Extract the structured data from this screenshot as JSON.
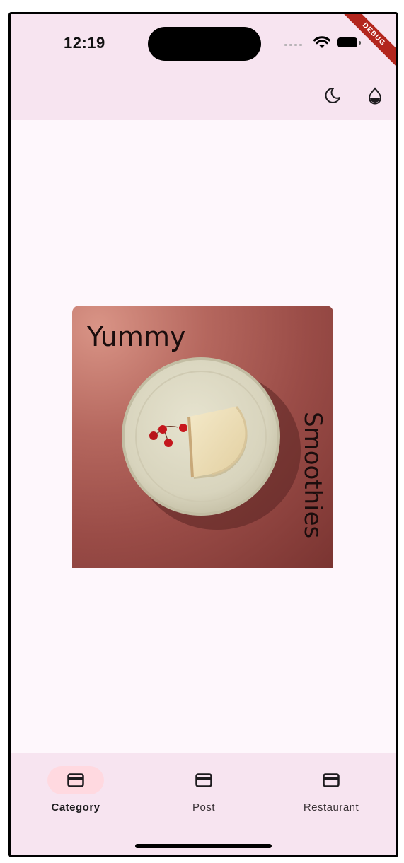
{
  "status_bar": {
    "time": "12:19",
    "debug_label": "DEBUG"
  },
  "app_bar": {
    "actions": [
      {
        "icon": "moon-icon"
      },
      {
        "icon": "water-drop-icon"
      }
    ]
  },
  "card": {
    "title": "Yummy",
    "subtitle": "Smoothies",
    "image": "cheesecake-plate"
  },
  "bottom_nav": {
    "selected_index": 0,
    "items": [
      {
        "label": "Category",
        "icon": "credit-card-icon"
      },
      {
        "label": "Post",
        "icon": "credit-card-icon"
      },
      {
        "label": "Restaurant",
        "icon": "credit-card-icon"
      }
    ]
  },
  "colors": {
    "surface": "#fef7fc",
    "app_bar": "#f7e4f0",
    "nav_indicator": "#ffd9e0",
    "card_gradient": [
      "#d99486",
      "#9a4c47",
      "#7a3431"
    ]
  }
}
